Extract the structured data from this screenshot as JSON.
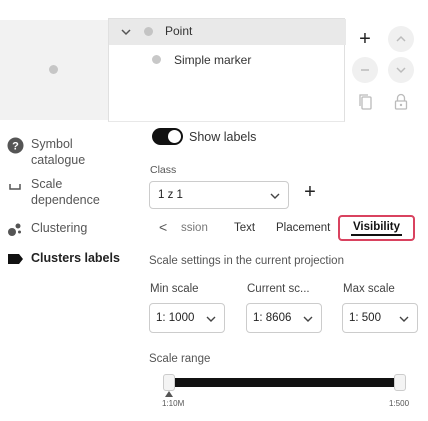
{
  "tree": {
    "items": [
      {
        "label": "Point",
        "expanded": true,
        "selected": true
      },
      {
        "label": "Simple marker"
      }
    ]
  },
  "toolbar": {
    "add": "+",
    "move_up": "chevron-up-icon",
    "move_down": "chevron-down-icon",
    "remove": "minus-icon",
    "duplicate": "copy-icon",
    "lock": "lock-icon"
  },
  "sidebar": {
    "items": [
      {
        "label": "Symbol catalogue",
        "icon": "help-icon"
      },
      {
        "label": "Scale dependence",
        "icon": "scale-icon"
      },
      {
        "label": "Clustering",
        "icon": "cluster-icon"
      },
      {
        "label": "Clusters labels",
        "icon": "label-tag-icon",
        "active": true
      }
    ]
  },
  "labels": {
    "show_labels": "Show labels",
    "show_labels_on": true,
    "class_label": "Class",
    "class_value": "1 z 1",
    "add_class": "+"
  },
  "tabs": {
    "prev": "<",
    "items": [
      "ssion",
      "Text",
      "Placement",
      "Visibility"
    ],
    "active": "Visibility"
  },
  "visibility": {
    "heading": "Scale settings in the current projection",
    "min_scale_label": "Min scale",
    "min_scale_value": "1: 1000",
    "current_scale_label": "Current sc...",
    "current_scale_value": "1: 8606",
    "max_scale_label": "Max scale",
    "max_scale_value": "1: 500",
    "scale_range_label": "Scale range",
    "range_min_label": "1:10M",
    "range_max_label": "1:500",
    "range_fill_fraction": 1.0
  },
  "colors": {
    "accent_outline": "#d9425f",
    "toggle_on": "#111111",
    "selected_row": "#e9e9e9"
  }
}
